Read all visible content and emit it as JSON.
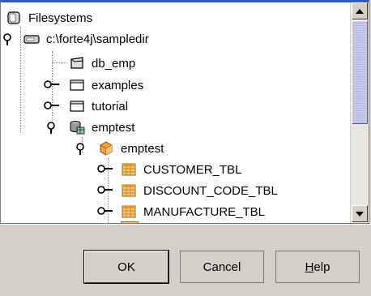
{
  "tree": {
    "root": {
      "label": "Filesystems",
      "icon": "filesystems-icon"
    },
    "nodes": [
      {
        "label": "c:\\forte4j\\sampledir",
        "icon": "drive-icon",
        "expanded": true
      },
      {
        "label": "db_emp",
        "icon": "database-icon"
      },
      {
        "label": "examples",
        "icon": "folder-icon",
        "expanded": false
      },
      {
        "label": "tutorial",
        "icon": "folder-icon",
        "expanded": false
      },
      {
        "label": "emptest",
        "icon": "database-schema-icon",
        "expanded": true
      },
      {
        "label": "emptest",
        "icon": "schema-cube-icon",
        "expanded": true
      },
      {
        "label": "CUSTOMER_TBL",
        "icon": "table-icon",
        "expanded": false
      },
      {
        "label": "DISCOUNT_CODE_TBL",
        "icon": "table-icon",
        "expanded": false
      },
      {
        "label": "MANUFACTURE_TBL",
        "icon": "table-icon",
        "expanded": false
      }
    ]
  },
  "scrollbar": {
    "position": 0.1
  },
  "buttons": {
    "ok": "OK",
    "cancel": "Cancel",
    "help_pre": "",
    "help_ul": "H",
    "help_post": "elp"
  },
  "colors": {
    "titlebar": "#2d5fb7",
    "background": "#d4d0c8",
    "thumb": "#c3c5e6"
  }
}
